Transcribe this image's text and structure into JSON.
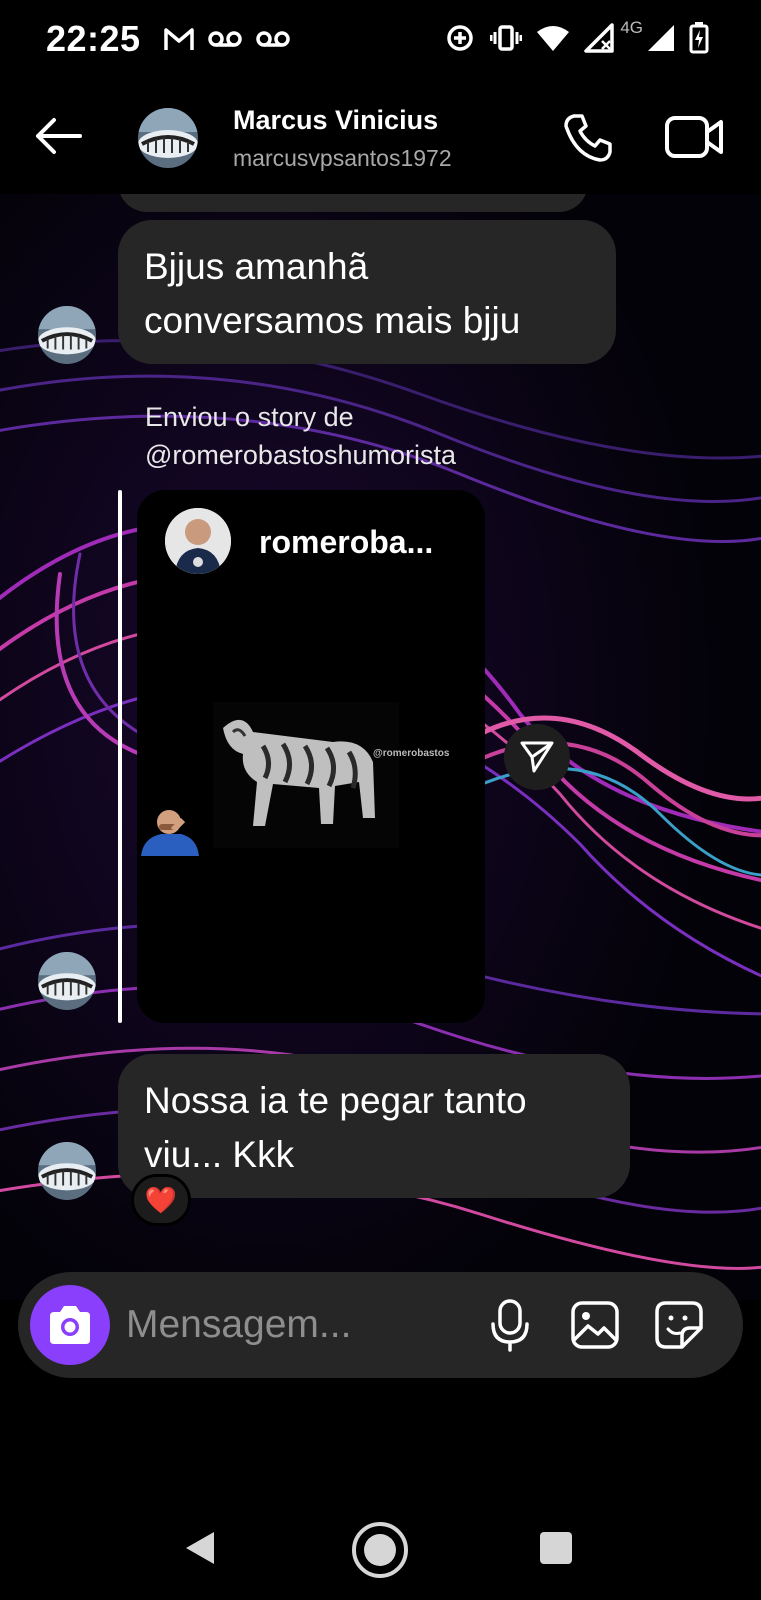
{
  "status_bar": {
    "time": "22:25",
    "left_icons": [
      "gmail-icon",
      "voicemail-icon",
      "voicemail-icon"
    ],
    "right_icons": [
      "data-saver-icon",
      "vibrate-icon",
      "wifi-icon",
      "signal-x-icon",
      "signal-icon",
      "battery-charging-icon"
    ],
    "network_label": "4G"
  },
  "header": {
    "contact_name": "Marcus Vinicius",
    "username": "marcusvpsantos1972",
    "back_icon": "arrow-left-icon",
    "call_icon": "phone-icon",
    "video_icon": "video-camera-icon"
  },
  "messages": [
    {
      "type": "text",
      "text": "Bjjus amanhã conversamos mais bjju"
    },
    {
      "type": "story",
      "caption": "Enviou o story de @romerobastoshumorista",
      "story_user": "romeroba...",
      "watermark": "@romerobastos"
    },
    {
      "type": "text",
      "text": "Nossa ia te pegar tanto viu... Kkk",
      "reaction": "❤️"
    }
  ],
  "composer": {
    "placeholder": "Mensagem...",
    "icons": [
      "camera-icon",
      "microphone-icon",
      "gallery-icon",
      "sticker-icon"
    ]
  },
  "colors": {
    "bubble": "#262626",
    "camera_button": "#8a3ffc",
    "muted_text": "#a8a8a8"
  }
}
